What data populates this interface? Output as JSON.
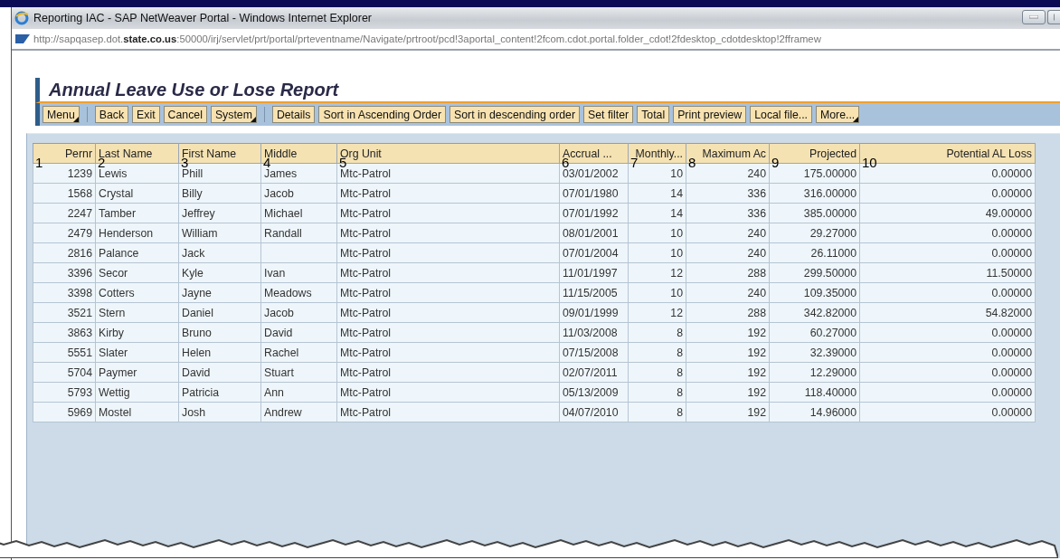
{
  "window": {
    "title": "Reporting IAC - SAP NetWeaver Portal - Windows Internet Explorer",
    "address": "http://sapqasep.dot.**state.co.us**:50000/irj/servlet/prt/portal/prteventname/Navigate/prtroot/pcd!3aportal_content!2fcom.cdot.portal.folder_cdot!2fdesktop_cdotdesktop!2fframew"
  },
  "report": {
    "title": "Annual Leave Use or Lose Report"
  },
  "toolbar": [
    [
      {
        "label": "Menu",
        "has_menu": true
      }
    ],
    [
      {
        "label": "Back",
        "has_menu": false
      },
      {
        "label": "Exit",
        "has_menu": false
      },
      {
        "label": "Cancel",
        "has_menu": false
      },
      {
        "label": "System",
        "has_menu": true
      }
    ],
    [
      {
        "label": "Details",
        "has_menu": false
      },
      {
        "label": "Sort in Ascending Order",
        "has_menu": false
      },
      {
        "label": "Sort in descending order",
        "has_menu": false
      },
      {
        "label": "Set filter",
        "has_menu": false
      },
      {
        "label": "Total",
        "has_menu": false
      },
      {
        "label": "Print preview",
        "has_menu": false
      },
      {
        "label": "Local file...",
        "has_menu": false
      },
      {
        "label": "More...",
        "has_menu": true
      }
    ]
  ],
  "table": {
    "columns": [
      {
        "label": "Pernr",
        "marker": "1"
      },
      {
        "label": "Last Name",
        "marker": "2"
      },
      {
        "label": "First Name",
        "marker": "3"
      },
      {
        "label": "Middle",
        "marker": "4"
      },
      {
        "label": "Org Unit",
        "marker": "5"
      },
      {
        "label": "Accrual ...",
        "marker": "6"
      },
      {
        "label": "Monthly...",
        "marker": "7"
      },
      {
        "label": "Maximum Ac",
        "marker": "8"
      },
      {
        "label": "Projected",
        "marker": "9"
      },
      {
        "label": "Potential AL Loss",
        "marker": "10"
      }
    ],
    "rows": [
      {
        "pernr": "1239",
        "last_name": "Lewis",
        "first_name": "Phill",
        "middle": "James",
        "org_unit": "Mtc-Patrol",
        "accrual": "03/01/2002",
        "monthly": "10",
        "maximum": "240",
        "projected": "175.00000",
        "loss": "0.00000"
      },
      {
        "pernr": "1568",
        "last_name": "Crystal",
        "first_name": "Billy",
        "middle": "Jacob",
        "org_unit": "Mtc-Patrol",
        "accrual": "07/01/1980",
        "monthly": "14",
        "maximum": "336",
        "projected": "316.00000",
        "loss": "0.00000"
      },
      {
        "pernr": "2247",
        "last_name": "Tamber",
        "first_name": "Jeffrey",
        "middle": "Michael",
        "org_unit": "Mtc-Patrol",
        "accrual": "07/01/1992",
        "monthly": "14",
        "maximum": "336",
        "projected": "385.00000",
        "loss": "49.00000"
      },
      {
        "pernr": "2479",
        "last_name": "Henderson",
        "first_name": "William",
        "middle": "Randall",
        "org_unit": "Mtc-Patrol",
        "accrual": "08/01/2001",
        "monthly": "10",
        "maximum": "240",
        "projected": "29.27000",
        "loss": "0.00000"
      },
      {
        "pernr": "2816",
        "last_name": "Palance",
        "first_name": "Jack",
        "org_unit": "Mtc-Patrol",
        "accrual": "07/01/2004",
        "monthly": "10",
        "maximum": "240",
        "projected": "26.11000",
        "loss": "0.00000"
      },
      {
        "pernr": "3396",
        "last_name": "Secor",
        "first_name": "Kyle",
        "middle": "Ivan",
        "org_unit": "Mtc-Patrol",
        "accrual": "11/01/1997",
        "monthly": "12",
        "maximum": "288",
        "projected": "299.50000",
        "loss": "11.50000"
      },
      {
        "pernr": "3398",
        "last_name": "Cotters",
        "first_name": "Jayne",
        "middle": "Meadows",
        "org_unit": "Mtc-Patrol",
        "accrual": "11/15/2005",
        "monthly": "10",
        "maximum": "240",
        "projected": "109.35000",
        "loss": "0.00000"
      },
      {
        "pernr": "3521",
        "last_name": "Stern",
        "first_name": "Daniel",
        "middle": "Jacob",
        "org_unit": "Mtc-Patrol",
        "accrual": "09/01/1999",
        "monthly": "12",
        "maximum": "288",
        "projected": "342.82000",
        "loss": "54.82000"
      },
      {
        "pernr": "3863",
        "last_name": "Kirby",
        "first_name": "Bruno",
        "middle": "David",
        "org_unit": "Mtc-Patrol",
        "accrual": "11/03/2008",
        "monthly": "8",
        "maximum": "192",
        "projected": "60.27000",
        "loss": "0.00000"
      },
      {
        "pernr": "5551",
        "last_name": "Slater",
        "first_name": "Helen",
        "middle": "Rachel",
        "org_unit": "Mtc-Patrol",
        "accrual": "07/15/2008",
        "monthly": "8",
        "maximum": "192",
        "projected": "32.39000",
        "loss": "0.00000"
      },
      {
        "pernr": "5704",
        "last_name": "Paymer",
        "first_name": "David",
        "middle": "Stuart",
        "org_unit": "Mtc-Patrol",
        "accrual": "02/07/2011",
        "monthly": "8",
        "maximum": "192",
        "projected": "12.29000",
        "loss": "0.00000"
      },
      {
        "pernr": "5793",
        "last_name": "Wettig",
        "first_name": "Patricia",
        "middle": "Ann",
        "org_unit": "Mtc-Patrol",
        "accrual": "05/13/2009",
        "monthly": "8",
        "maximum": "192",
        "projected": "118.40000",
        "loss": "0.00000"
      },
      {
        "pernr": "5969",
        "last_name": "Mostel",
        "first_name": "Josh",
        "middle": "Andrew",
        "org_unit": "Mtc-Patrol",
        "accrual": "04/07/2010",
        "monthly": "8",
        "maximum": "192",
        "projected": "14.96000",
        "loss": "0.00000"
      }
    ]
  }
}
